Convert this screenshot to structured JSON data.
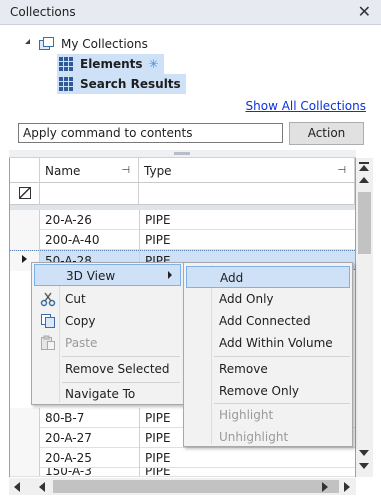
{
  "window": {
    "title": "Collections"
  },
  "tree": {
    "root": "My Collections",
    "items": [
      {
        "label": "Elements",
        "badge": "✳"
      },
      {
        "label": "Search Results"
      }
    ]
  },
  "links": {
    "show_all": "Show All Collections"
  },
  "command": {
    "value": "Apply command to contents",
    "button": "Action"
  },
  "grid": {
    "columns": [
      "Name",
      "Type"
    ],
    "rows": [
      {
        "name": "20-A-26",
        "type": "PIPE"
      },
      {
        "name": "200-A-40",
        "type": "PIPE"
      },
      {
        "name": "50-A-28",
        "type": "PIPE"
      }
    ],
    "bottom_rows": [
      {
        "name": "80-B-7",
        "type": "PIPE"
      },
      {
        "name": "20-A-27",
        "type": "PIPE"
      },
      {
        "name": "20-A-25",
        "type": "PIPE"
      },
      {
        "name": "150-A-3",
        "type": "PIPE"
      }
    ]
  },
  "menu": {
    "items": [
      {
        "label": "3D View",
        "mnemonic": "V",
        "submenu": true
      },
      {
        "label": "Cut",
        "icon": "scissors-icon"
      },
      {
        "label": "Copy",
        "icon": "copy-icon"
      },
      {
        "label": "Paste",
        "icon": "paste-icon",
        "disabled": true
      },
      {
        "label": "Remove Selected"
      },
      {
        "label": "Navigate To",
        "mnemonic": "N"
      }
    ]
  },
  "submenu": {
    "items": [
      {
        "label": "Add"
      },
      {
        "label": "Add Only"
      },
      {
        "label": "Add Connected"
      },
      {
        "label": "Add Within Volume"
      },
      {
        "label": "Remove"
      },
      {
        "label": "Remove Only"
      },
      {
        "label": "Highlight",
        "disabled": true
      },
      {
        "label": "Unhighlight",
        "disabled": true
      }
    ]
  },
  "colors": {
    "selection": "#cfe1f7",
    "link": "#0a33dd",
    "accent": "#4a8fd8"
  }
}
